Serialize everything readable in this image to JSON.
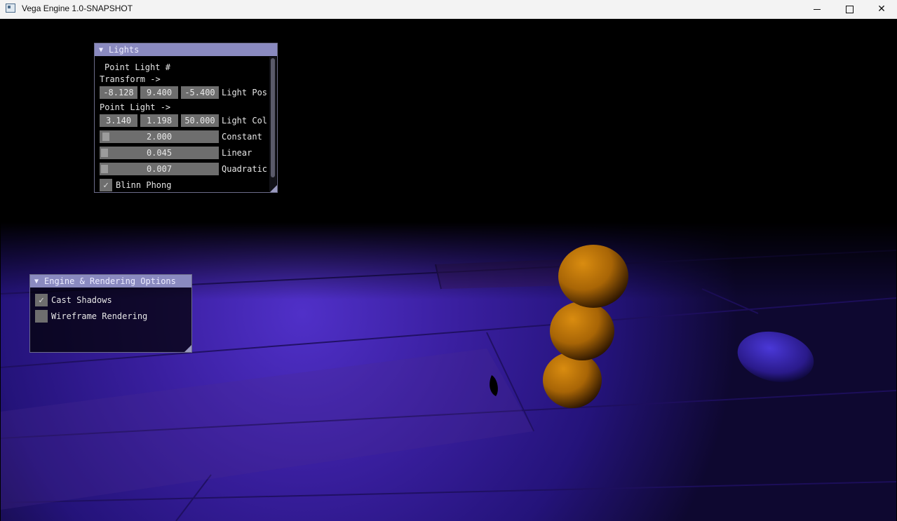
{
  "window": {
    "title": "Vega Engine 1.0-SNAPSHOT",
    "minimize_glyph": "",
    "maximize_glyph": "",
    "close_glyph": "✕"
  },
  "lights_panel": {
    "title": "Lights",
    "collapse_glyph": "▼",
    "point_light_header": "Point Light #",
    "transform_label": "Transform ->",
    "light_pos": [
      "-8.128",
      "9.400",
      "-5.400"
    ],
    "light_pos_label": "Light Pos",
    "point_light_label": "Point Light ->",
    "light_col": [
      "3.140",
      "1.198",
      "50.000"
    ],
    "light_col_label": "Light Col",
    "constant_value": "2.000",
    "constant_label": "Constant",
    "linear_value": "0.045",
    "linear_label": "Linear",
    "quadratic_value": "0.007",
    "quadratic_label": "Quadratic",
    "blinn_phong_label": "Blinn Phong",
    "blinn_phong_checked": true
  },
  "engine_panel": {
    "title": "Engine & Rendering Options",
    "collapse_glyph": "▼",
    "cast_shadows_label": "Cast Shadows",
    "cast_shadows_checked": true,
    "wireframe_label": "Wireframe Rendering",
    "wireframe_checked": false
  },
  "scene": {
    "floor_color": "#3a1fa0",
    "sphere_color": "#c8800c",
    "icons": [
      "app-icon",
      "minimize-icon",
      "maximize-icon",
      "close-icon",
      "checkmark-icon",
      "collapse-arrow-icon"
    ]
  }
}
